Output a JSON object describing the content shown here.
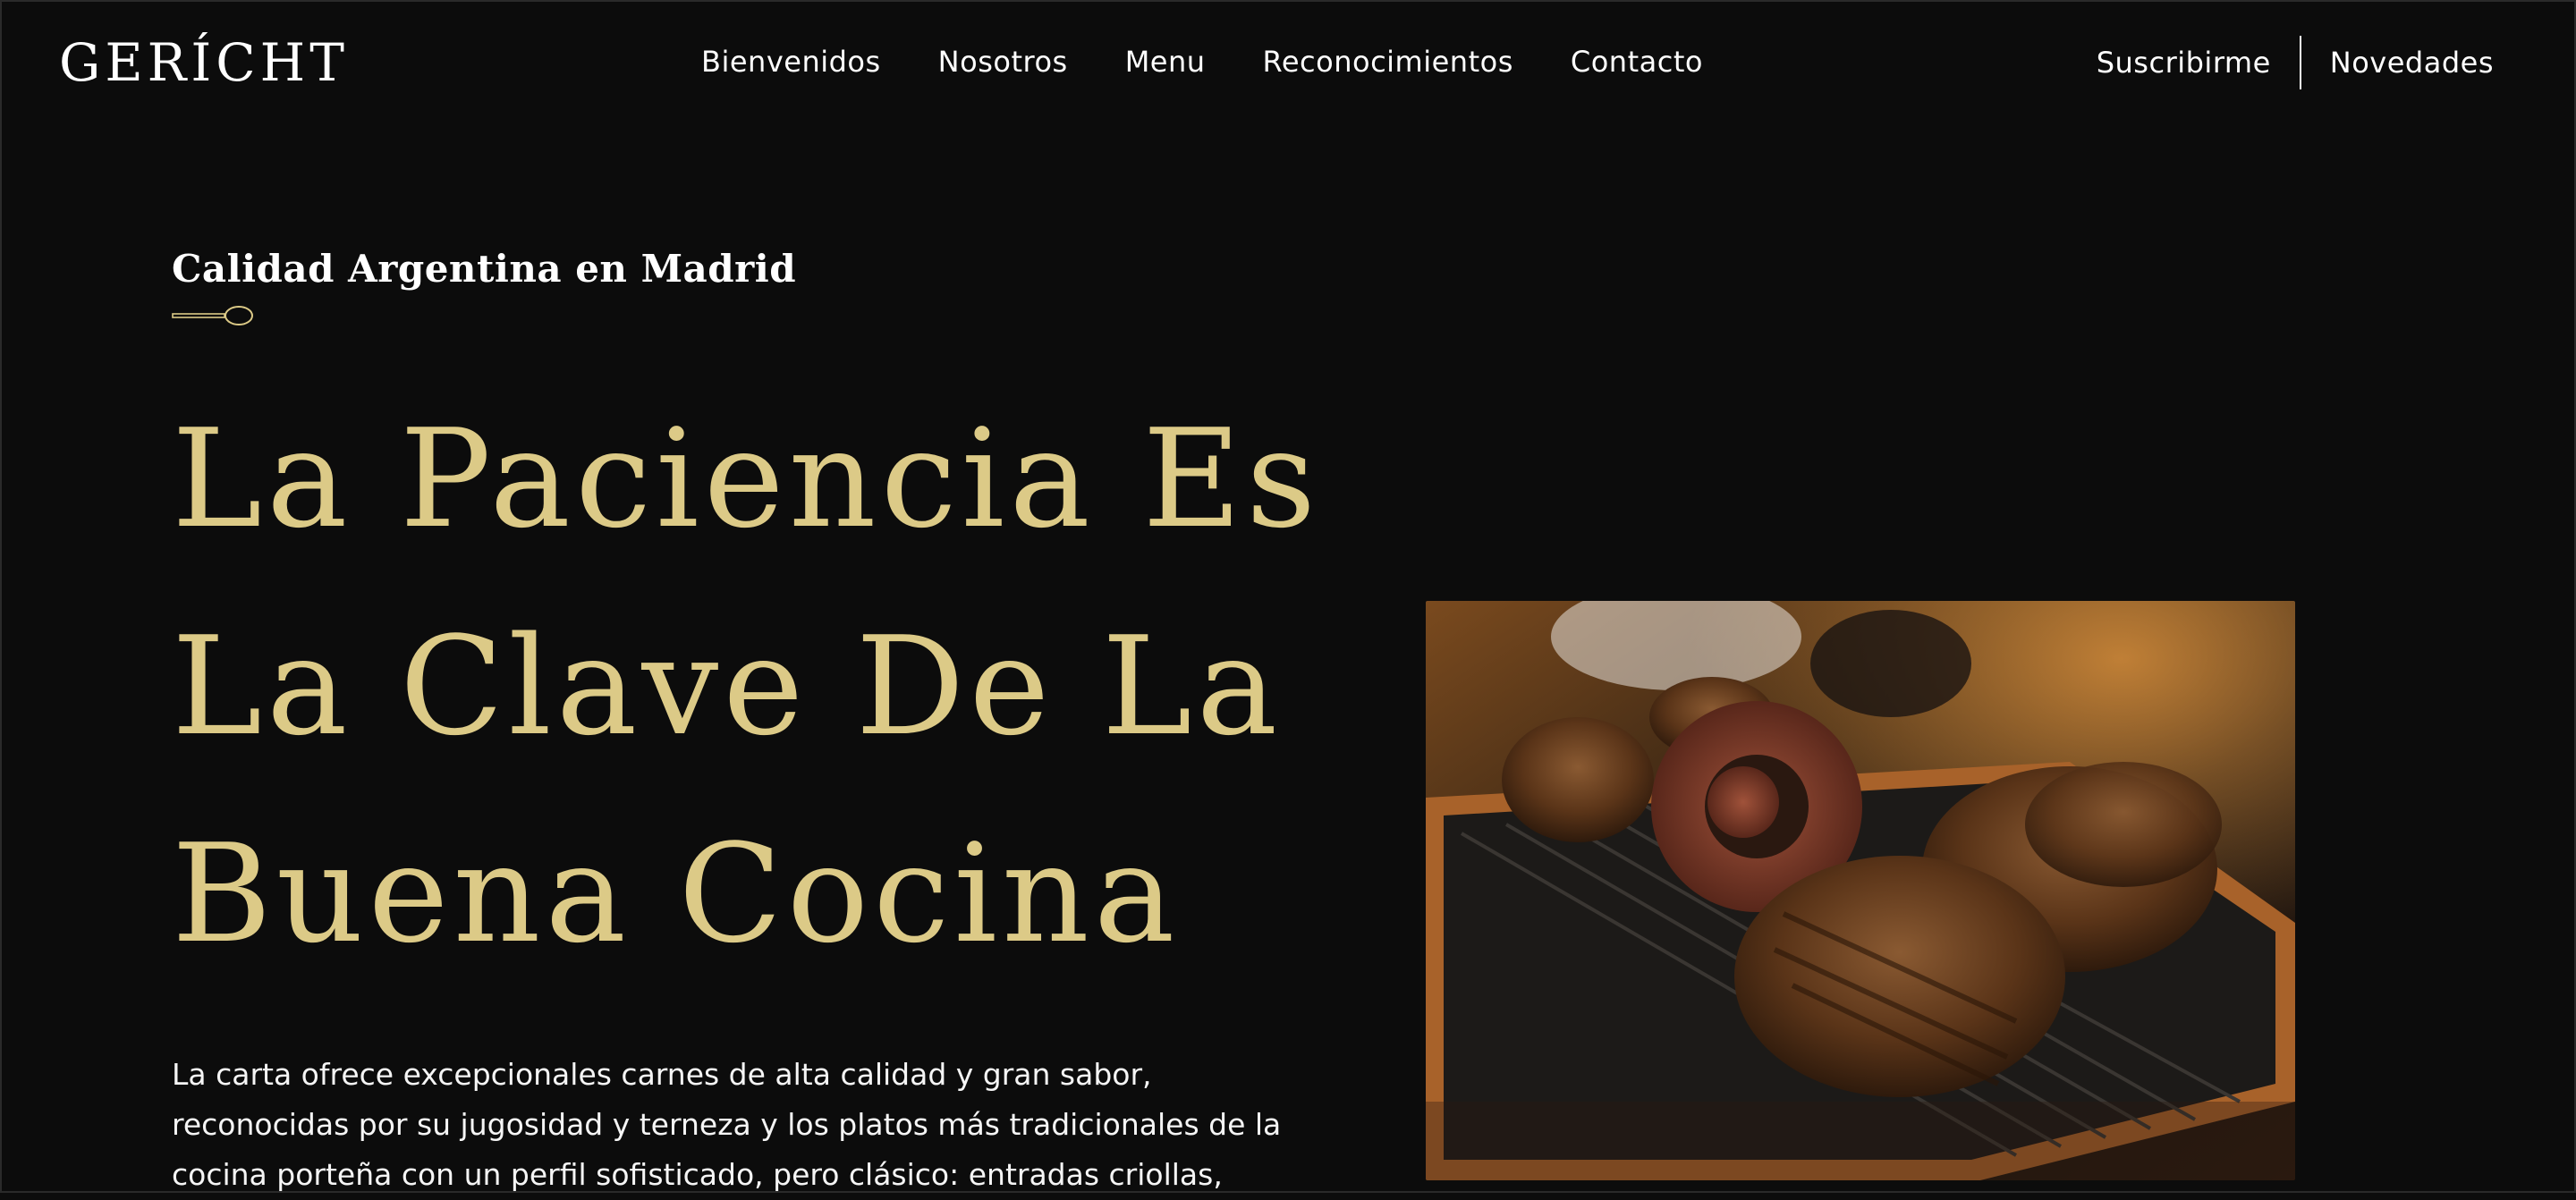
{
  "brand": {
    "logo": "GERÍCHT"
  },
  "nav": {
    "links": [
      "Bienvenidos",
      "Nosotros",
      "Menu",
      "Reconocimientos",
      "Contacto"
    ],
    "subscribe": "Suscribirme",
    "news": "Novedades"
  },
  "hero": {
    "subtitle": "Calidad Argentina en Madrid",
    "headline_lines": [
      "La Paciencia Es",
      "La Clave De La",
      "Buena Cocina"
    ],
    "description": "La carta ofrece excepcionales carnes de alta calidad y gran sabor, reconocidas por su jugosidad y terneza y los platos más tradicionales de la cocina porteña con un perfil sofisticado, pero clásico: entradas criollas,",
    "image_icon": "grilled-meat-photo"
  },
  "colors": {
    "background": "#0c0c0c",
    "accent_gold": "#dcca87",
    "text": "#ffffff"
  }
}
